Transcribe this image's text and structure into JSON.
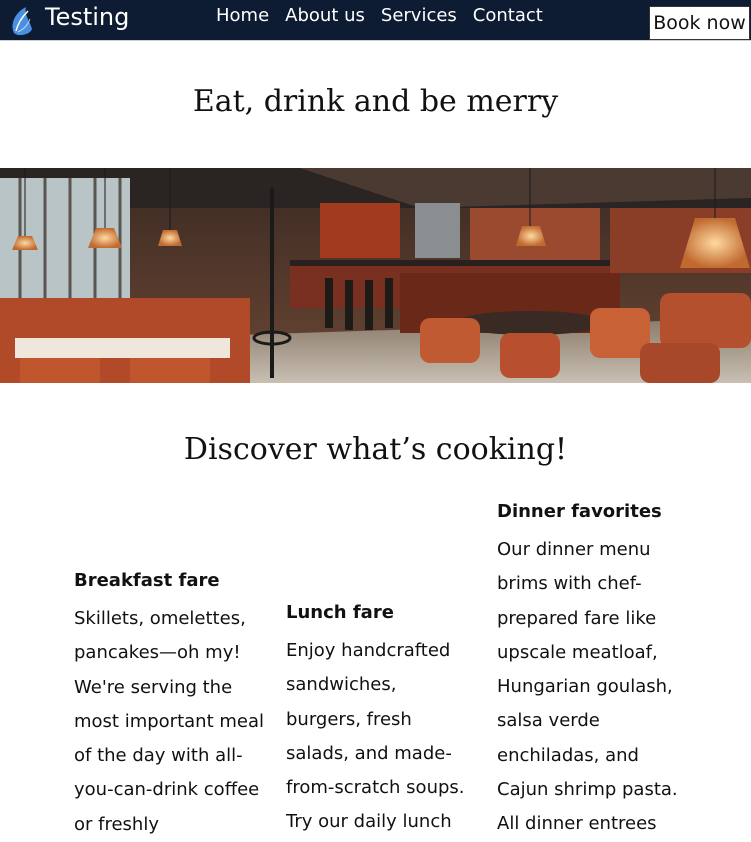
{
  "header": {
    "brand": "Testing",
    "nav": [
      "Home",
      "About us",
      "Services",
      "Contact"
    ],
    "cta": "Book now"
  },
  "hero": {
    "title": "Eat, drink and be merry"
  },
  "menu": {
    "title": "Discover what’s cooking!",
    "columns": [
      {
        "heading": "Breakfast fare",
        "body": "Skillets, omelettes, pancakes—oh my! We're serving the most important meal of the day with all-you-can-drink coffee or freshly"
      },
      {
        "heading": "Lunch fare",
        "body": "Enjoy handcrafted sandwiches, burgers, fresh salads, and made-from-scratch soups. Try our daily lunch"
      },
      {
        "heading": "Dinner favorites",
        "body": "Our dinner menu brims with chef-prepared fare like upscale meatloaf, Hungarian goulash, salsa verde enchiladas, and Cajun shrimp pasta. All dinner entrees"
      }
    ]
  },
  "colors": {
    "navbar_bg": "#0d1b33",
    "logo_blue": "#4a8fe0"
  },
  "icons": {
    "logo": "leaf-drop-icon"
  }
}
